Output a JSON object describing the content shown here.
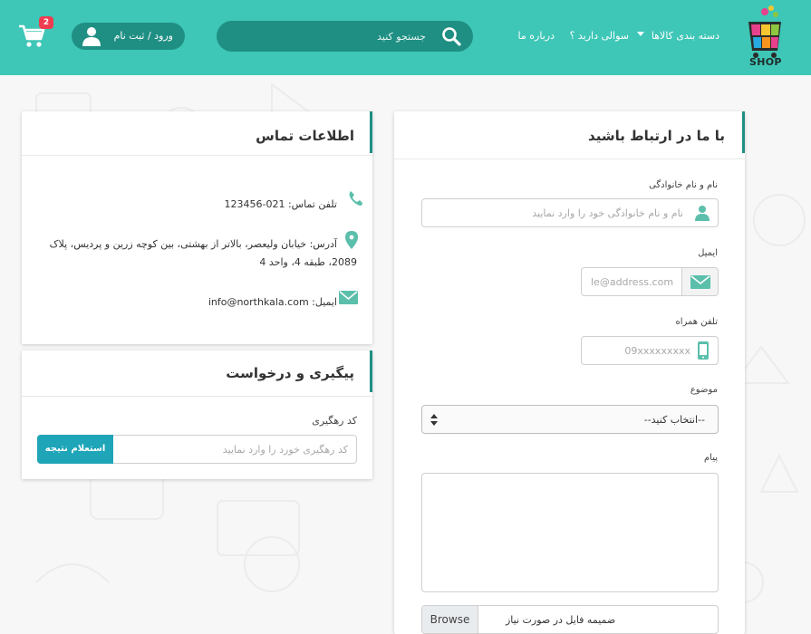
{
  "header": {
    "logo_text": "SHOP",
    "nav": {
      "categories": "دسته بندی کالاها",
      "question": "سوالی دارید ؟",
      "about": "درباره ما"
    },
    "search_placeholder": "جستجو کنید",
    "login_label": "ورود / ثبت نام",
    "cart_count": "2"
  },
  "contact_form": {
    "title": "با ما در ارتباط باشید",
    "name_label": "نام و نام خانوادگی",
    "name_placeholder": "نام و نام خانوادگی خود را وارد نمایید",
    "email_label": "ایمیل",
    "email_placeholder": "le@address.com",
    "phone_label": "تلفن همراه",
    "phone_placeholder": "09xxxxxxxxx",
    "subject_label": "موضوع",
    "subject_value": "--انتخاب کنید--",
    "message_label": "پیام",
    "file_label": "ضمیمه فایل در صورت نیاز",
    "browse_label": "Browse"
  },
  "contact_info": {
    "title": "اطلاعات تماس",
    "phone_label": "تلفن تماس:",
    "phone_value": "021-123456",
    "address_line1": "آدرس: خیابان ولیعصر، بالاتر از بهشتی، بین کوچه زرین و پردیس، پلاک",
    "address_line2": "2089، طبقه 4، واحد 4",
    "email_label": "ایمیل:",
    "email_value": "info@northkala.com"
  },
  "tracking": {
    "title": "پیگیری و درخواست",
    "code_label": "کد رهگیری",
    "code_placeholder": "کد رهگیری خورد را وارد نمایید",
    "submit_label": "استعلام نتیجه"
  },
  "colors": {
    "header": "#3ec6b6",
    "dark_teal": "#1f8f83",
    "button_blue": "#1ea5b8",
    "badge_red": "#ef3d4f",
    "icon_teal": "#5bbfab"
  }
}
